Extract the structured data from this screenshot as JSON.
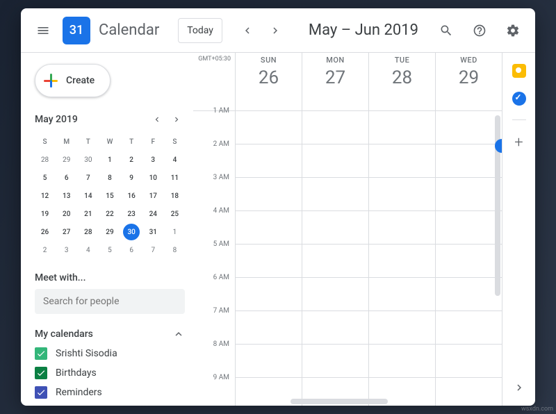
{
  "header": {
    "logo_day": "31",
    "app_title": "Calendar",
    "today_label": "Today",
    "date_range": "May – Jun 2019"
  },
  "create_label": "Create",
  "mini_cal": {
    "title": "May 2019",
    "dow": [
      "S",
      "M",
      "T",
      "W",
      "T",
      "F",
      "S"
    ],
    "weeks": [
      [
        {
          "d": "28",
          "o": true
        },
        {
          "d": "29",
          "o": true
        },
        {
          "d": "30",
          "o": true
        },
        {
          "d": "1"
        },
        {
          "d": "2"
        },
        {
          "d": "3"
        },
        {
          "d": "4"
        }
      ],
      [
        {
          "d": "5"
        },
        {
          "d": "6"
        },
        {
          "d": "7"
        },
        {
          "d": "8"
        },
        {
          "d": "9"
        },
        {
          "d": "10"
        },
        {
          "d": "11"
        }
      ],
      [
        {
          "d": "12"
        },
        {
          "d": "13"
        },
        {
          "d": "14"
        },
        {
          "d": "15"
        },
        {
          "d": "16"
        },
        {
          "d": "17"
        },
        {
          "d": "18"
        }
      ],
      [
        {
          "d": "19"
        },
        {
          "d": "20"
        },
        {
          "d": "21"
        },
        {
          "d": "22"
        },
        {
          "d": "23"
        },
        {
          "d": "24"
        },
        {
          "d": "25"
        }
      ],
      [
        {
          "d": "26"
        },
        {
          "d": "27"
        },
        {
          "d": "28"
        },
        {
          "d": "29"
        },
        {
          "d": "30",
          "today": true
        },
        {
          "d": "31"
        },
        {
          "d": "1",
          "o": true
        }
      ],
      [
        {
          "d": "2",
          "o": true
        },
        {
          "d": "3",
          "o": true
        },
        {
          "d": "4",
          "o": true
        },
        {
          "d": "5",
          "o": true
        },
        {
          "d": "6",
          "o": true
        },
        {
          "d": "7",
          "o": true
        },
        {
          "d": "8",
          "o": true
        }
      ]
    ]
  },
  "meet_with": {
    "title": "Meet with...",
    "placeholder": "Search for people"
  },
  "my_calendars": {
    "title": "My calendars",
    "items": [
      {
        "label": "Srishti Sisodia",
        "color": "#33b679"
      },
      {
        "label": "Birthdays",
        "color": "#0b8043"
      },
      {
        "label": "Reminders",
        "color": "#3f51b5"
      }
    ]
  },
  "grid": {
    "timezone": "GMT+05:30",
    "day_headers": [
      {
        "dow": "SUN",
        "num": "26"
      },
      {
        "dow": "MON",
        "num": "27"
      },
      {
        "dow": "TUE",
        "num": "28"
      },
      {
        "dow": "WED",
        "num": "29"
      }
    ],
    "hours": [
      "1 AM",
      "2 AM",
      "3 AM",
      "4 AM",
      "5 AM",
      "6 AM",
      "7 AM",
      "8 AM",
      "9 AM"
    ]
  },
  "watermark": "wsxdn.com"
}
